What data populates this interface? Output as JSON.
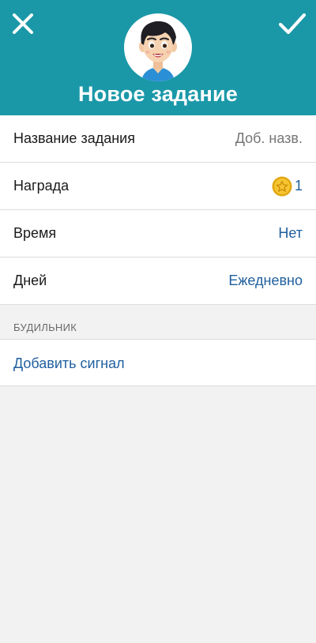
{
  "header": {
    "title": "Новое задание",
    "close_icon": "close-icon",
    "confirm_icon": "checkmark-icon",
    "avatar_icon": "child-avatar-icon",
    "background_color": "#1a98a8"
  },
  "fields": [
    {
      "label": "Название задания",
      "value": "Доб. назв."
    },
    {
      "label": "Награда",
      "value": "1",
      "icon": "coin-star-icon"
    },
    {
      "label": "Время",
      "value": "Нет"
    },
    {
      "label": "Дней",
      "value": "Ежедневно"
    }
  ],
  "alarm": {
    "section_title": "БУДИЛЬНИК",
    "add_label": "Добавить сигнал"
  },
  "colors": {
    "accent_text": "#1f5f9e",
    "page_background": "#f2f2f2"
  }
}
